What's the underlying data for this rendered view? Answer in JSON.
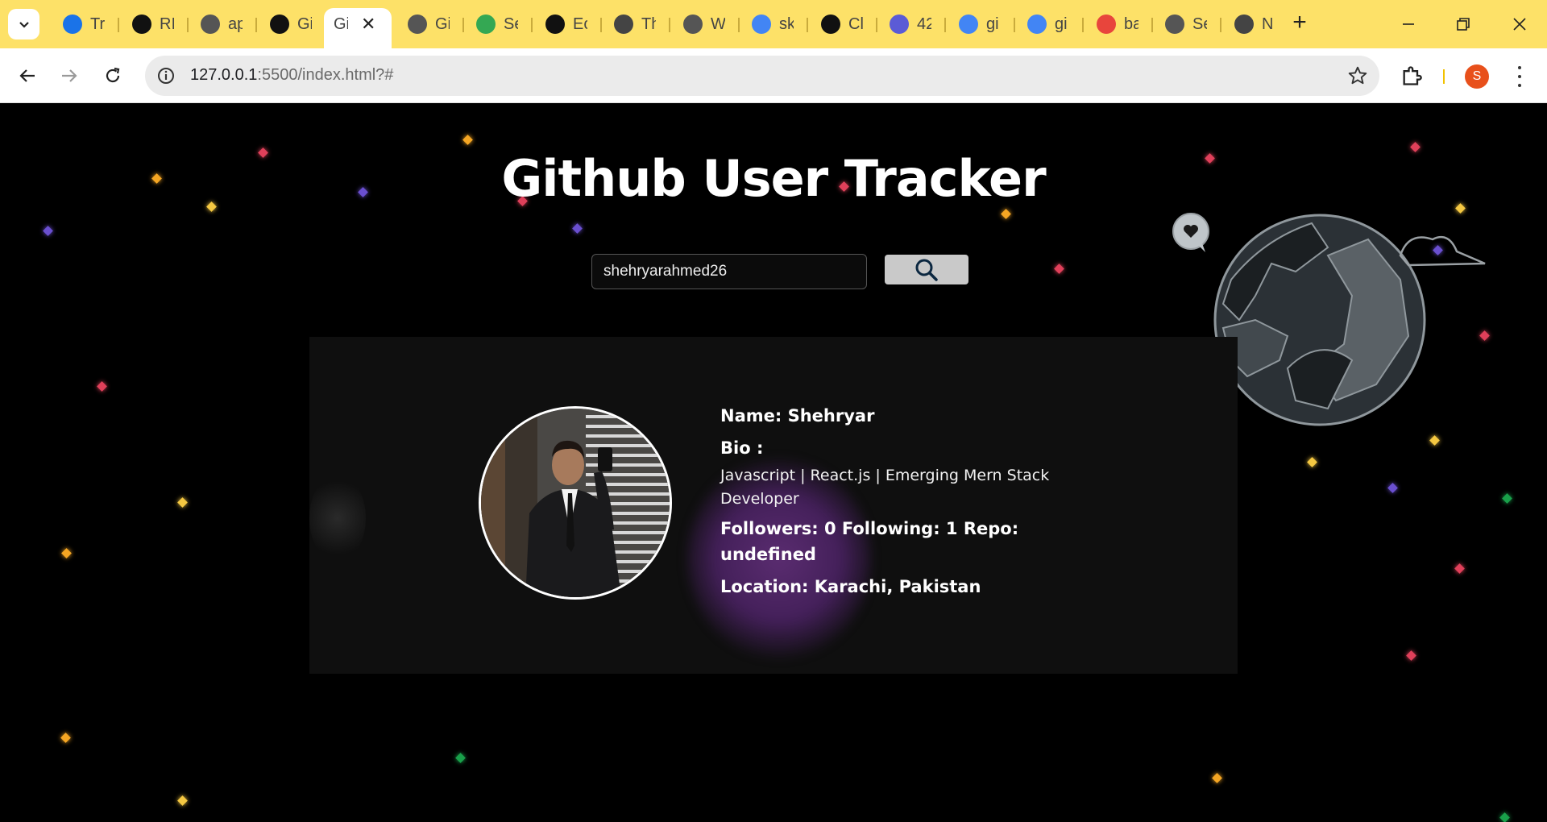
{
  "browser": {
    "tabs": [
      {
        "title": "Tr",
        "icon": "chrome-refresh-icon",
        "color": "#1a73e8"
      },
      {
        "title": "RI",
        "icon": "github-icon",
        "color": "#111111"
      },
      {
        "title": "ap",
        "icon": "globe-icon",
        "color": "#555555"
      },
      {
        "title": "Gi",
        "icon": "github-icon",
        "color": "#111111"
      },
      {
        "title": "Gi",
        "icon": "none",
        "color": "#ffffff",
        "active": true
      },
      {
        "title": "Gi",
        "icon": "globe-icon",
        "color": "#555555"
      },
      {
        "title": "Se",
        "icon": "google-apps-icon",
        "color": "#34a853"
      },
      {
        "title": "Ec",
        "icon": "github-icon",
        "color": "#111111"
      },
      {
        "title": "Th",
        "icon": "css-icon",
        "color": "#444444"
      },
      {
        "title": "W",
        "icon": "globe-icon",
        "color": "#555555"
      },
      {
        "title": "sk",
        "icon": "google-icon",
        "color": "#4285f4"
      },
      {
        "title": "Cl",
        "icon": "openai-icon",
        "color": "#111111"
      },
      {
        "title": "42",
        "icon": "code-icon",
        "color": "#5b5bd6"
      },
      {
        "title": "gi",
        "icon": "google-icon",
        "color": "#4285f4"
      },
      {
        "title": "gi",
        "icon": "google-icon",
        "color": "#4285f4"
      },
      {
        "title": "ba",
        "icon": "asterisk-icon",
        "color": "#e8453c"
      },
      {
        "title": "Se",
        "icon": "globe-icon",
        "color": "#555555"
      },
      {
        "title": "N",
        "icon": "chrome-icon",
        "color": "#444444"
      }
    ],
    "url_host": "127.0.0.1",
    "url_rest": ":5500/index.html?#",
    "profile_initial": "S"
  },
  "page": {
    "title": "Github User Tracker",
    "search": {
      "value": "shehryarahmed26"
    },
    "profile": {
      "name_line": "Name: Shehryar",
      "bio_label": "Bio :",
      "bio_text": "Javascript | React.js | Emerging Mern Stack Developer",
      "stats_line": "Followers: 0 Following: 1 Repo: undefined",
      "location_line": "Location: Karachi, Pakistan"
    }
  }
}
